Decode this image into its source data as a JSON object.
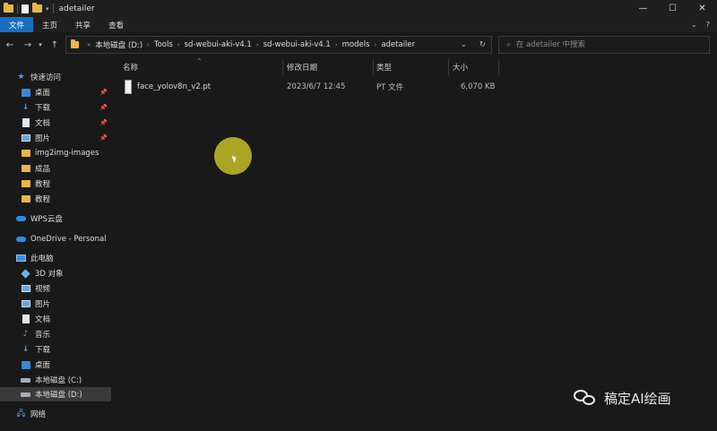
{
  "window": {
    "title": "adetailer",
    "controls": {
      "minimize": "—",
      "maximize": "☐",
      "close": "✕"
    }
  },
  "ribbon": {
    "tabs": [
      "文件",
      "主页",
      "共享",
      "查看"
    ],
    "active_tab": "文件",
    "accent": "#1a6fbf",
    "right": {
      "collapse": "⌄",
      "help": "?"
    }
  },
  "address": {
    "crumbs": [
      "本地磁盘 (D:)",
      "Tools",
      "sd-webui-aki-v4.1",
      "sd-webui-aki-v4.1",
      "models",
      "adetailer"
    ],
    "dropdown": "⌄",
    "refresh": "↻"
  },
  "search": {
    "placeholder": "在 adetailer 中搜索",
    "icon": "search-icon"
  },
  "sidebar": {
    "quick_access_label": "快速访问",
    "quick_access": [
      {
        "label": "桌面",
        "icon": "desktop-icon",
        "pinned": true
      },
      {
        "label": "下载",
        "icon": "download-icon",
        "pinned": true
      },
      {
        "label": "文档",
        "icon": "document-icon",
        "pinned": true
      },
      {
        "label": "图片",
        "icon": "picture-icon",
        "pinned": true
      },
      {
        "label": "img2img-images",
        "icon": "folder-icon",
        "pinned": false
      },
      {
        "label": "成品",
        "icon": "folder-icon",
        "pinned": false
      },
      {
        "label": "教程",
        "icon": "folder-icon",
        "pinned": false
      },
      {
        "label": "教程",
        "icon": "folder-icon",
        "pinned": false
      }
    ],
    "wps": "WPS云盘",
    "onedrive": "OneDrive - Personal",
    "this_pc_label": "此电脑",
    "this_pc": [
      {
        "label": "3D 对象",
        "icon": "3d-objects-icon"
      },
      {
        "label": "视频",
        "icon": "video-icon"
      },
      {
        "label": "图片",
        "icon": "picture-icon"
      },
      {
        "label": "文档",
        "icon": "document-icon"
      },
      {
        "label": "音乐",
        "icon": "music-icon"
      },
      {
        "label": "下载",
        "icon": "download-icon"
      },
      {
        "label": "桌面",
        "icon": "desktop-icon"
      },
      {
        "label": "本地磁盘 (C:)",
        "icon": "drive-icon"
      },
      {
        "label": "本地磁盘 (D:)",
        "icon": "drive-icon",
        "selected": true
      }
    ],
    "network": "网络"
  },
  "columns": {
    "name": "名称",
    "modified": "修改日期",
    "type": "类型",
    "size": "大小"
  },
  "files": [
    {
      "name": "face_yolov8n_v2.pt",
      "modified": "2023/6/7 12:45",
      "type": "PT 文件",
      "size": "6,070 KB"
    }
  ],
  "watermark": {
    "text": "稿定AI绘画"
  }
}
